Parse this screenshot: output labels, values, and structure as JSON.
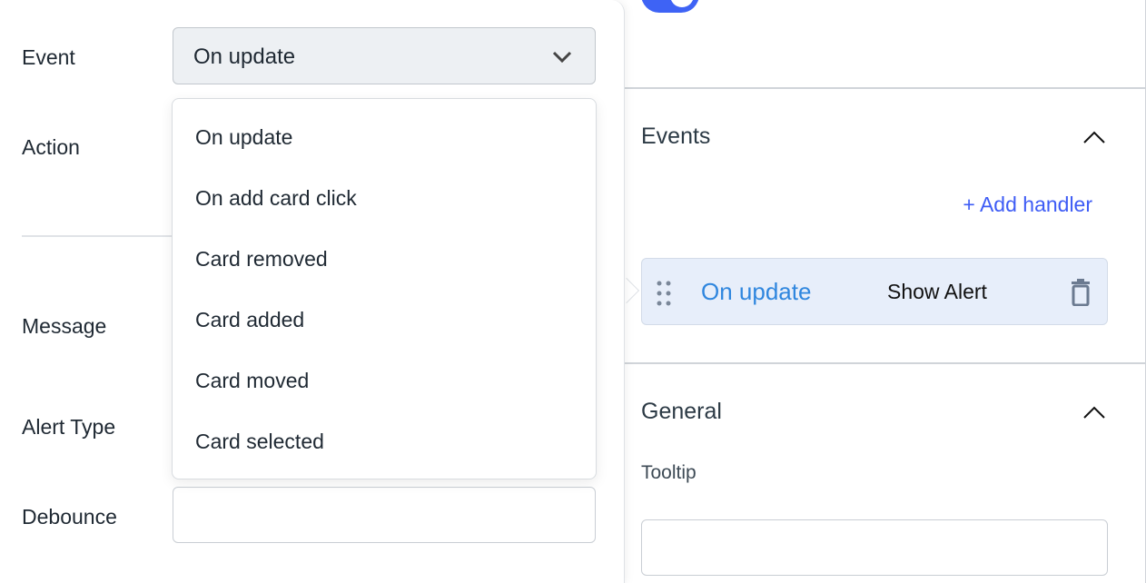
{
  "left_panel": {
    "labels": {
      "event": "Event",
      "action": "Action",
      "message": "Message",
      "alert_type": "Alert Type",
      "debounce": "Debounce"
    },
    "event_select": {
      "value": "On update",
      "options": [
        "On update",
        "On add card click",
        "Card removed",
        "Card added",
        "Card moved",
        "Card selected"
      ]
    },
    "debounce_value": ""
  },
  "right_panel": {
    "toggle_on": true,
    "events": {
      "title": "Events",
      "add_handler": "+ Add handler",
      "handler": {
        "event": "On update",
        "action": "Show Alert"
      }
    },
    "general": {
      "title": "General",
      "tooltip_label": "Tooltip",
      "tooltip_value": ""
    }
  },
  "colors": {
    "accent": "#3e63f5",
    "handler_event": "#2f86de",
    "handler_bg": "#e7eefa"
  }
}
